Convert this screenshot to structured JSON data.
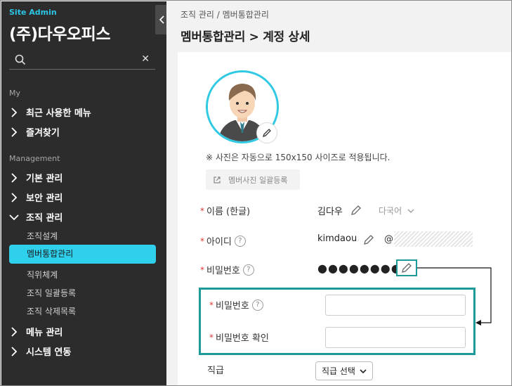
{
  "sidebar": {
    "site_label": "Site Admin",
    "company": "(주)다우오피스",
    "search_placeholder": "",
    "section_my": "My",
    "my_items": [
      {
        "label": "최근 사용한 메뉴"
      },
      {
        "label": "즐겨찾기"
      }
    ],
    "section_management": "Management",
    "mgmt_items": [
      {
        "label": "기본 관리"
      },
      {
        "label": "보안 관리"
      },
      {
        "label": "조직 관리"
      }
    ],
    "org_subitems": [
      {
        "label": "조직설계"
      },
      {
        "label": "멤버통합관리",
        "active": true
      },
      {
        "label": "직위체계"
      },
      {
        "label": "조직 일괄등록"
      },
      {
        "label": "조직 삭제목록"
      }
    ],
    "bottom_items": [
      {
        "label": "메뉴 관리"
      },
      {
        "label": "시스템 연동"
      }
    ],
    "accent_color": "#2fd0ec"
  },
  "main": {
    "breadcrumb": "조직 관리 / 멤버통합관리",
    "title": "멤버통합관리 > 계정 상세",
    "photo_note": "※ 사진은 자동으로 150x150 사이즈로 적용됩니다.",
    "bulk_photo_button": "멤버사진 일괄등록",
    "fields": {
      "name_label": "이름 (한글)",
      "name_value": "김다우",
      "lang_select": "다국어",
      "id_label": "아이디",
      "id_value": "kimdaou",
      "at_sign": "@",
      "password_label": "비밀번호",
      "password_mask": "●●●●●●●●",
      "pw_new_label": "비밀번호",
      "pw_confirm_label": "비밀번호 확인",
      "rank_label": "직급",
      "rank_select": "직급 선택"
    },
    "highlight_color": "#1c9a9a"
  }
}
